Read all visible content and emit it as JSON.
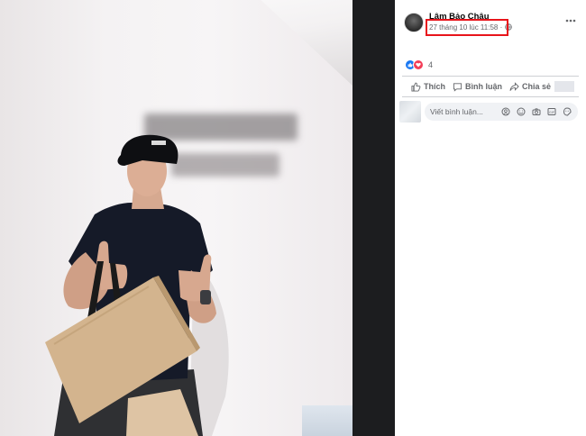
{
  "post": {
    "author_name": "Lâm Bảo Châu",
    "timestamp": "27 tháng 10 lúc 11:58 ·",
    "reaction_count": "4"
  },
  "actions": {
    "like": "Thích",
    "comment": "Bình luận",
    "share": "Chia sẻ"
  },
  "comment_box": {
    "placeholder": "Viết bình luận..."
  },
  "colors": {
    "highlight": "#e8141b",
    "like": "#1877f2",
    "love": "#f33e58"
  }
}
